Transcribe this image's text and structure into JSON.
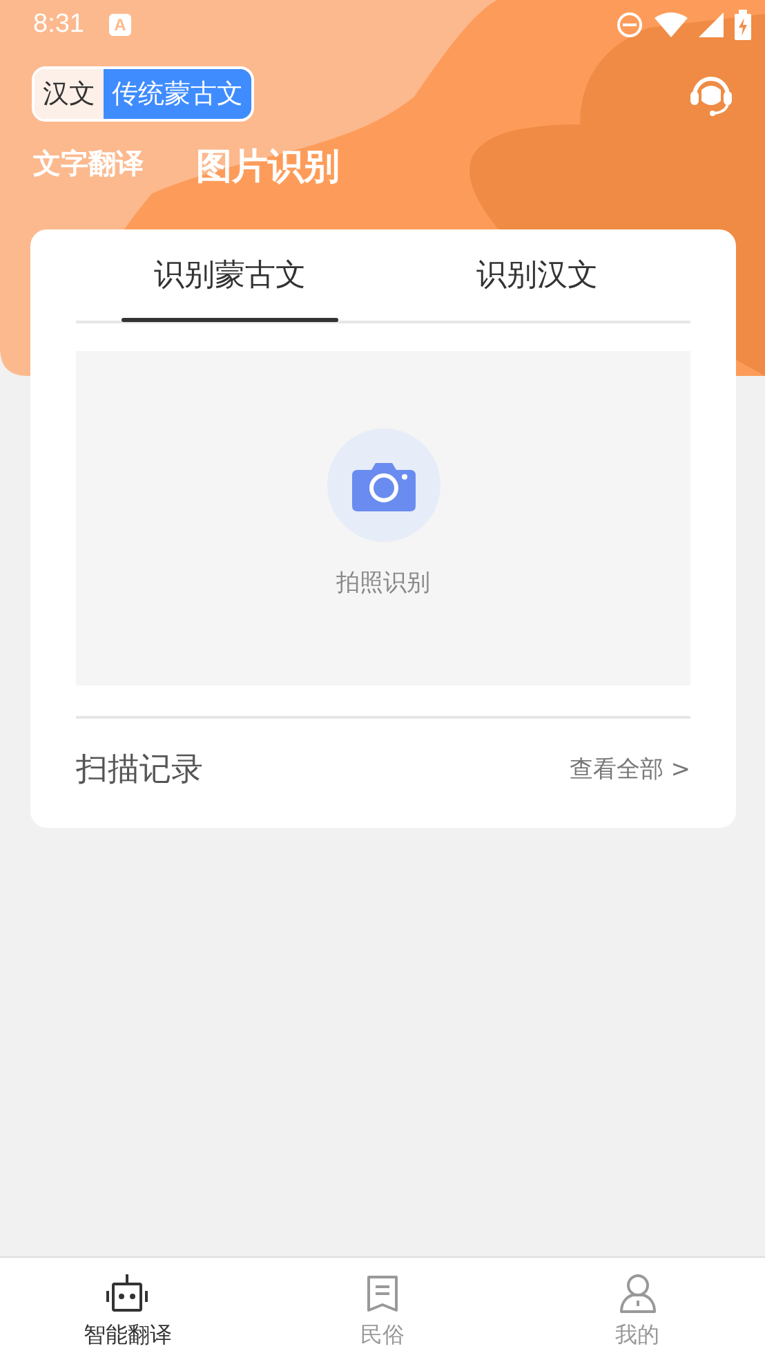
{
  "status_bar": {
    "time": "8:31",
    "notification_glyph": "A"
  },
  "language_toggle": [
    {
      "label": "汉文",
      "selected": false
    },
    {
      "label": "传统蒙古文",
      "selected": true
    }
  ],
  "mode_tabs": [
    {
      "label": "文字翻译",
      "selected": false
    },
    {
      "label": "图片识别",
      "selected": true
    }
  ],
  "card": {
    "tabs": [
      {
        "label": "识别蒙古文",
        "selected": true
      },
      {
        "label": "识别汉文",
        "selected": false
      }
    ],
    "capture": {
      "label": "拍照识别"
    },
    "records": {
      "title": "扫描记录",
      "link": "查看全部 >"
    }
  },
  "bottom_nav": [
    {
      "label": "智能翻译",
      "kind": "robot",
      "selected": true
    },
    {
      "label": "民俗",
      "kind": "document",
      "selected": false
    },
    {
      "label": "我的",
      "kind": "person",
      "selected": false
    }
  ]
}
